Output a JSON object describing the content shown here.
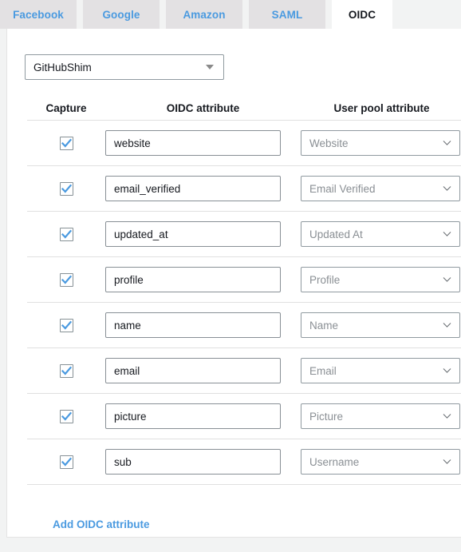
{
  "tabs": [
    {
      "label": "Facebook",
      "active": false
    },
    {
      "label": "Google",
      "active": false
    },
    {
      "label": "Amazon",
      "active": false
    },
    {
      "label": "SAML",
      "active": false
    },
    {
      "label": "OIDC",
      "active": true
    }
  ],
  "provider": {
    "selected": "GitHubShim",
    "caret_icon": "caret-down-icon"
  },
  "table": {
    "headers": {
      "capture": "Capture",
      "oidc_attribute": "OIDC attribute",
      "user_pool_attribute": "User pool attribute"
    },
    "rows": [
      {
        "checked": true,
        "oidc_attribute": "website",
        "user_pool_attribute": "Website"
      },
      {
        "checked": true,
        "oidc_attribute": "email_verified",
        "user_pool_attribute": "Email Verified"
      },
      {
        "checked": true,
        "oidc_attribute": "updated_at",
        "user_pool_attribute": "Updated At"
      },
      {
        "checked": true,
        "oidc_attribute": "profile",
        "user_pool_attribute": "Profile"
      },
      {
        "checked": true,
        "oidc_attribute": "name",
        "user_pool_attribute": "Name"
      },
      {
        "checked": true,
        "oidc_attribute": "email",
        "user_pool_attribute": "Email"
      },
      {
        "checked": true,
        "oidc_attribute": "picture",
        "user_pool_attribute": "Picture"
      },
      {
        "checked": true,
        "oidc_attribute": "sub",
        "user_pool_attribute": "Username"
      }
    ]
  },
  "add_link": {
    "label": "Add OIDC attribute"
  },
  "colors": {
    "link_blue": "#4a9ae0",
    "checkbox_blue": "#4a9ae0",
    "tab_inactive_bg": "#e3e1e3",
    "panel_bg": "#ffffff",
    "page_bg": "#f2f3f3"
  }
}
